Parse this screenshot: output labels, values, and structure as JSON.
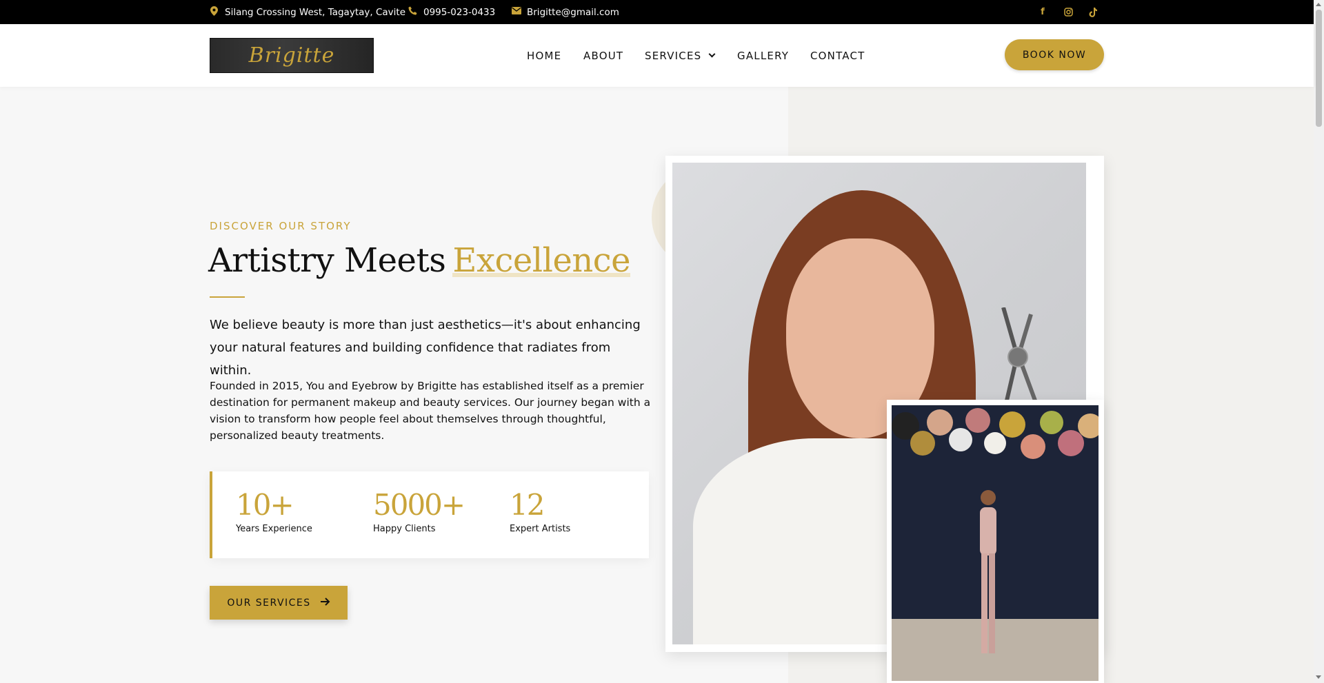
{
  "topbar": {
    "address": "Silang Crossing West, Tagaytay, Cavite",
    "phone": "0995-023-0433",
    "email": "Brigitte@gmail.com",
    "address_icon": "map-pin-icon",
    "phone_icon": "phone-icon",
    "email_icon": "envelope-icon",
    "social": [
      "facebook-icon",
      "instagram-icon",
      "tiktok-icon"
    ]
  },
  "header": {
    "logo_text": "Brigitte",
    "nav": [
      "HOME",
      "ABOUT",
      "SERVICES",
      "GALLERY",
      "CONTACT"
    ],
    "book_now": "BOOK NOW"
  },
  "hero": {
    "kicker": "DISCOVER OUR STORY",
    "title_main": "Artistry Meets",
    "title_highlight": "Excellence",
    "lead": "We believe beauty is more than just aesthetics—it's about enhancing your natural features and building confidence that radiates from within.",
    "body": "Founded in 2015, You and Eyebrow by Brigitte has established itself as a premier destination for permanent makeup and beauty services. Our journey began with a vision to transform how people feel about themselves through thoughtful, personalized beauty treatments.",
    "stats": [
      {
        "number": "10+",
        "label": "Years Experience"
      },
      {
        "number": "5000+",
        "label": "Happy Clients"
      },
      {
        "number": "12",
        "label": "Expert Artists"
      }
    ],
    "cta": "OUR SERVICES"
  },
  "colors": {
    "accent": "#c9a43a",
    "topbar_bg": "#000000",
    "page_bg": "#f7f7f7"
  }
}
